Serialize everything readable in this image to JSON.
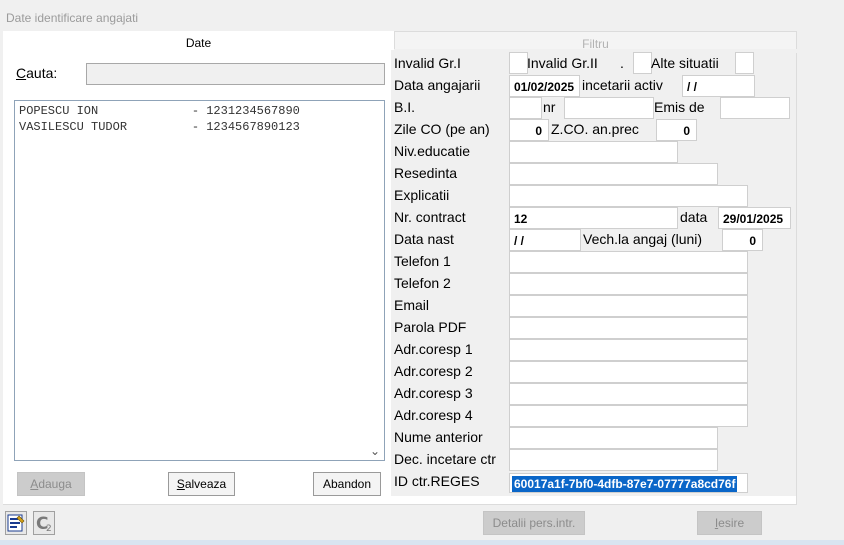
{
  "window": {
    "title": "Date identificare angajati"
  },
  "tabs": {
    "date": "Date",
    "filtru": "Filtru"
  },
  "search": {
    "label_prefix": "C",
    "label_rest": "auta:",
    "value": ""
  },
  "employees": [
    "POPESCU ION             - 1231234567890",
    "VASILESCU TUDOR         - 1234567890123"
  ],
  "left_buttons": {
    "adauga_u": "A",
    "adauga_rest": "dauga",
    "salveaza_u": "S",
    "salveaza_rest": "alveaza",
    "abandon": "Abandon"
  },
  "form": {
    "invalid_gr1": "Invalid Gr.I",
    "invalid_gr2": "Invalid Gr.II",
    "dot": ".",
    "alte_situatii": "Alte situatii",
    "data_angajarii_label": "Data angajarii",
    "data_angajarii_value": "01/02/2025",
    "incetarii_activ_label": "incetarii activ",
    "incetarii_activ_value": " / /",
    "bi_label": "B.I.",
    "nr_label": "nr",
    "emis_de_label": "Emis de",
    "zile_co_label": "Zile CO (pe an)",
    "zile_co_value": "0",
    "zco_an_prec_label": "Z.CO. an.prec",
    "zco_an_prec_value": "0",
    "niv_educatie_label": "Niv.educatie",
    "resedinta_label": "Resedinta",
    "explicatii_label": "Explicatii",
    "nr_contract_label": "Nr. contract",
    "nr_contract_value": "12",
    "data_label": "data",
    "data_value": "29/01/2025",
    "data_nast_label": "Data nast",
    "data_nast_value": " / /",
    "vech_label": "Vech.la angaj (luni)",
    "vech_value": "0",
    "telefon1_label": "Telefon 1",
    "telefon2_label": "Telefon 2",
    "email_label": "Email",
    "parola_pdf_label": "Parola PDF",
    "adr_coresp1_label": "Adr.coresp 1",
    "adr_coresp2_label": "Adr.coresp 2",
    "adr_coresp3_label": "Adr.coresp 3",
    "adr_coresp4_label": "Adr.coresp 4",
    "nume_anterior_label": "Nume anterior",
    "dec_incetare_label": "Dec. incetare ctr",
    "id_ctr_reges_label": "ID ctr.REGES",
    "id_ctr_reges_value": "60017a1f-7bf0-4dfb-87e7-07777a8cd76f"
  },
  "bottom_buttons": {
    "detalii": "Detalii pers.intr.",
    "iesire_u": "I",
    "iesire_rest": "esire"
  },
  "icons": [
    "edit-form-icon",
    "calculator-c-icon"
  ]
}
